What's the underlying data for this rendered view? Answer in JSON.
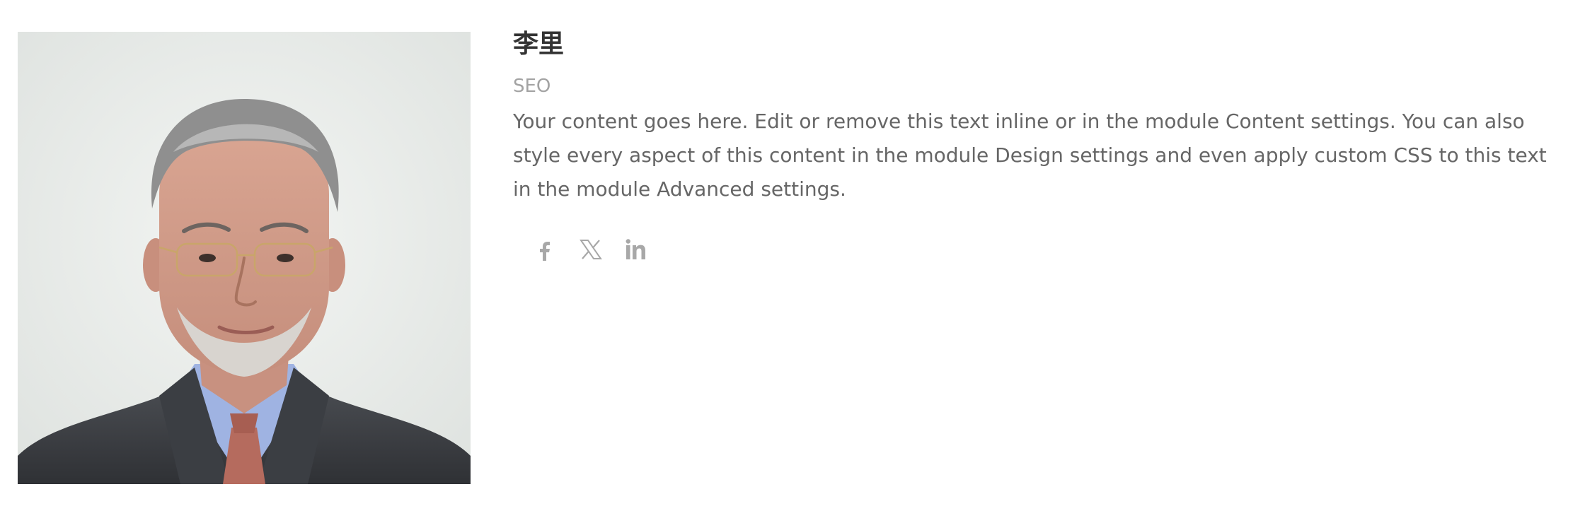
{
  "team_member": {
    "name": "李里",
    "position": "SEO",
    "bio": "Your content goes here. Edit or remove this text inline or in the module Content settings. You can also style every aspect of this content in the module Design settings and even apply custom CSS to this text in the module Advanced settings.",
    "photo_alt": "portrait photo"
  },
  "social": [
    {
      "icon": "facebook-icon",
      "label": "f"
    },
    {
      "icon": "x-twitter-icon",
      "label": "X"
    },
    {
      "icon": "linkedin-icon",
      "label": "in"
    }
  ],
  "colors": {
    "name": "#333333",
    "position": "#a3a3a3",
    "bio": "#666666",
    "social_icon": "#a8a8a8"
  }
}
